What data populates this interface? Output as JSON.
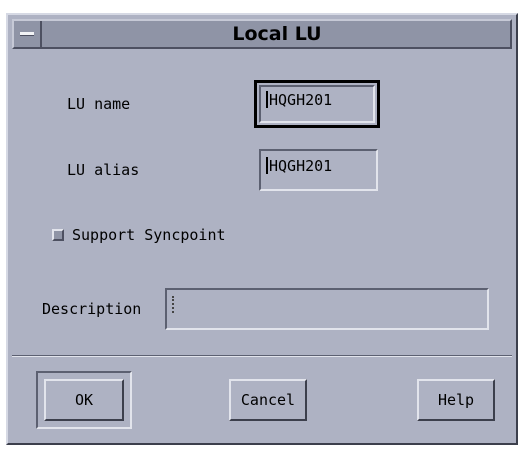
{
  "window": {
    "title": "Local LU"
  },
  "form": {
    "lu_name": {
      "label": "LU name",
      "value": "HQGH201"
    },
    "lu_alias": {
      "label": "LU alias",
      "value": "HQGH201"
    },
    "syncpoint": {
      "label": "Support Syncpoint",
      "checked": false
    },
    "description": {
      "label": "Description",
      "value": ""
    }
  },
  "buttons": {
    "ok": "OK",
    "cancel": "Cancel",
    "help": "Help"
  },
  "icons": {
    "window_menu": "window-menu-icon"
  }
}
